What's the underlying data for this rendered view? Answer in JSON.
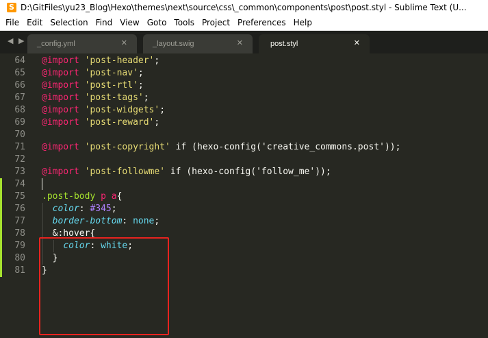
{
  "window": {
    "title": "D:\\GitFiles\\yu23_Blog\\Hexo\\themes\\next\\source\\css\\_common\\components\\post\\post.styl - Sublime Text (U...",
    "app_icon_letter": "S"
  },
  "menu": [
    "File",
    "Edit",
    "Selection",
    "Find",
    "View",
    "Goto",
    "Tools",
    "Project",
    "Preferences",
    "Help"
  ],
  "tabs": [
    {
      "label": "_config.yml",
      "close": "✕",
      "active": false
    },
    {
      "label": "_layout.swig",
      "close": "✕",
      "active": false
    },
    {
      "label": "post.styl",
      "close": "✕",
      "active": true
    }
  ],
  "nav_arrows": "◀ ▶",
  "lines": [
    {
      "num": "64",
      "tokens": [
        {
          "t": "@import",
          "c": "at"
        },
        {
          "t": " ",
          "c": "plain"
        },
        {
          "t": "'post-header'",
          "c": "str"
        },
        {
          "t": ";",
          "c": "plain"
        }
      ]
    },
    {
      "num": "65",
      "tokens": [
        {
          "t": "@import",
          "c": "at"
        },
        {
          "t": " ",
          "c": "plain"
        },
        {
          "t": "'post-nav'",
          "c": "str"
        },
        {
          "t": ";",
          "c": "plain"
        }
      ]
    },
    {
      "num": "66",
      "tokens": [
        {
          "t": "@import",
          "c": "at"
        },
        {
          "t": " ",
          "c": "plain"
        },
        {
          "t": "'post-rtl'",
          "c": "str"
        },
        {
          "t": ";",
          "c": "plain"
        }
      ]
    },
    {
      "num": "67",
      "tokens": [
        {
          "t": "@import",
          "c": "at"
        },
        {
          "t": " ",
          "c": "plain"
        },
        {
          "t": "'post-tags'",
          "c": "str"
        },
        {
          "t": ";",
          "c": "plain"
        }
      ]
    },
    {
      "num": "68",
      "tokens": [
        {
          "t": "@import",
          "c": "at"
        },
        {
          "t": " ",
          "c": "plain"
        },
        {
          "t": "'post-widgets'",
          "c": "str"
        },
        {
          "t": ";",
          "c": "plain"
        }
      ]
    },
    {
      "num": "69",
      "tokens": [
        {
          "t": "@import",
          "c": "at"
        },
        {
          "t": " ",
          "c": "plain"
        },
        {
          "t": "'post-reward'",
          "c": "str"
        },
        {
          "t": ";",
          "c": "plain"
        }
      ]
    },
    {
      "num": "70",
      "tokens": []
    },
    {
      "num": "71",
      "tokens": [
        {
          "t": "@import",
          "c": "at"
        },
        {
          "t": " ",
          "c": "plain"
        },
        {
          "t": "'post-copyright'",
          "c": "str"
        },
        {
          "t": " if (hexo-config(",
          "c": "plain"
        },
        {
          "t": "'creative_commons.post'",
          "c": "plain"
        },
        {
          "t": "));",
          "c": "plain"
        }
      ]
    },
    {
      "num": "72",
      "tokens": []
    },
    {
      "num": "73",
      "tokens": [
        {
          "t": "@import",
          "c": "at"
        },
        {
          "t": " ",
          "c": "plain"
        },
        {
          "t": "'post-followme'",
          "c": "str"
        },
        {
          "t": " if (hexo-config(",
          "c": "plain"
        },
        {
          "t": "'follow_me'",
          "c": "plain"
        },
        {
          "t": "));",
          "c": "plain"
        }
      ]
    },
    {
      "num": "74",
      "tokens": []
    },
    {
      "num": "75",
      "tokens": [
        {
          "t": ".post-body",
          "c": "sel"
        },
        {
          "t": " ",
          "c": "plain"
        },
        {
          "t": "p",
          "c": "tag"
        },
        {
          "t": " ",
          "c": "plain"
        },
        {
          "t": "a",
          "c": "tag"
        },
        {
          "t": "{",
          "c": "plain"
        }
      ]
    },
    {
      "num": "76",
      "tokens": [
        {
          "t": "  ",
          "c": "plain"
        },
        {
          "t": "color",
          "c": "prop"
        },
        {
          "t": ": ",
          "c": "plain"
        },
        {
          "t": "#345",
          "c": "num"
        },
        {
          "t": ";",
          "c": "plain"
        }
      ]
    },
    {
      "num": "77",
      "tokens": [
        {
          "t": "  ",
          "c": "plain"
        },
        {
          "t": "border-bottom",
          "c": "prop"
        },
        {
          "t": ": ",
          "c": "plain"
        },
        {
          "t": "none",
          "c": "val"
        },
        {
          "t": ";",
          "c": "plain"
        }
      ]
    },
    {
      "num": "78",
      "tokens": [
        {
          "t": "  &:hover{",
          "c": "plain"
        }
      ]
    },
    {
      "num": "79",
      "tokens": [
        {
          "t": "    ",
          "c": "plain"
        },
        {
          "t": "color",
          "c": "prop"
        },
        {
          "t": ": ",
          "c": "plain"
        },
        {
          "t": "white",
          "c": "val"
        },
        {
          "t": ";",
          "c": "plain"
        }
      ]
    },
    {
      "num": "80",
      "tokens": [
        {
          "t": "  }",
          "c": "plain"
        }
      ]
    },
    {
      "num": "81",
      "tokens": [
        {
          "t": "}",
          "c": "plain"
        }
      ]
    }
  ],
  "modified_lines": [
    "74",
    "75",
    "76",
    "77",
    "78",
    "79",
    "80",
    "81"
  ],
  "colors": {
    "background": "#272822",
    "keyword": "#f92672",
    "string": "#e6db74",
    "selector": "#a6e22e",
    "property": "#66d9ef",
    "number": "#ae81ff",
    "highlight_box": "#e8231f"
  }
}
